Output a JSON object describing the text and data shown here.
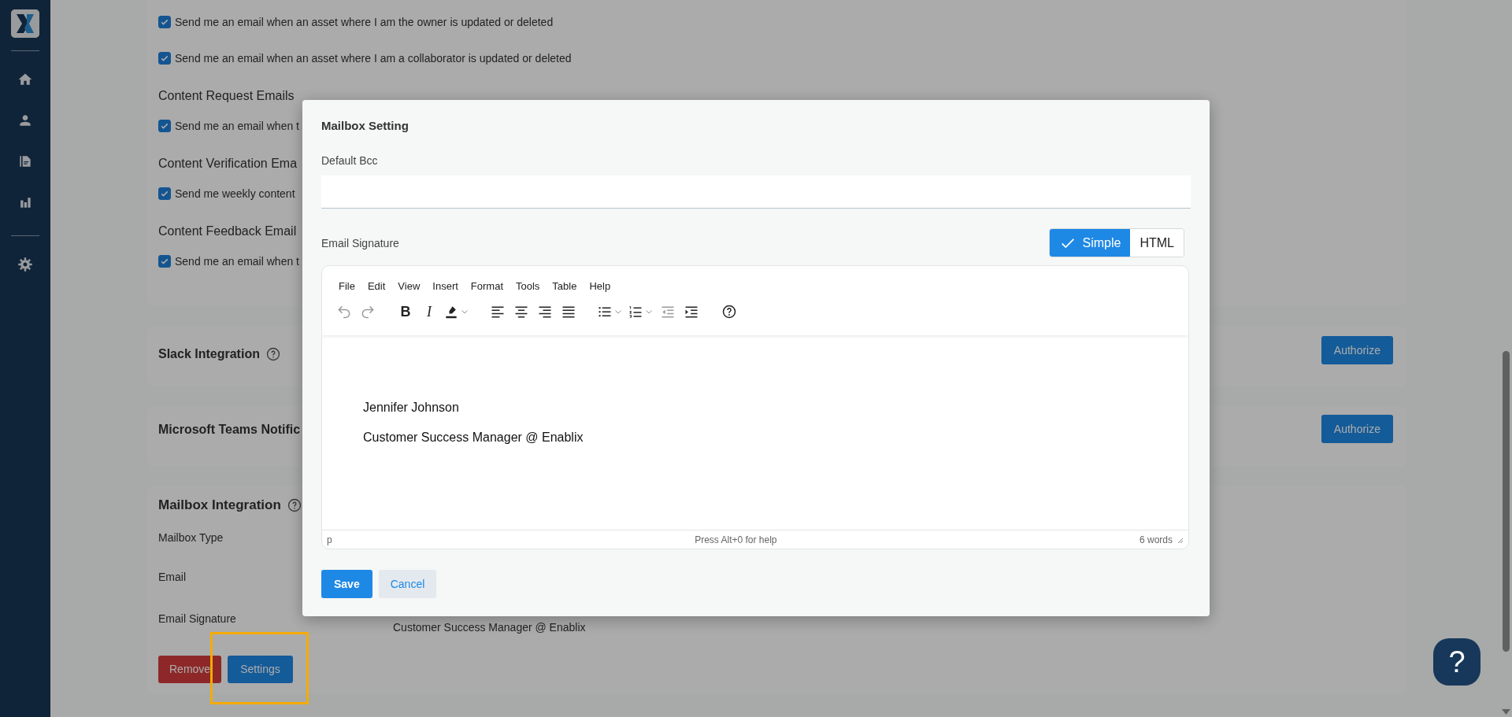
{
  "notifications": [
    {
      "kind": "checkbox",
      "label": "Send me an email when an asset where I am the owner is updated or deleted",
      "checked": true
    },
    {
      "kind": "checkbox",
      "label": "Send me an email when an asset where I am a collaborator is updated or deleted",
      "checked": true
    },
    {
      "kind": "heading",
      "label": "Content Request Emails"
    },
    {
      "kind": "checkbox",
      "label": "Send me an email when t",
      "checked": true
    },
    {
      "kind": "heading",
      "label": "Content Verification Ema"
    },
    {
      "kind": "checkbox",
      "label": "Send me weekly content",
      "checked": true
    },
    {
      "kind": "heading",
      "label": "Content Feedback Email"
    },
    {
      "kind": "checkbox",
      "label": "Send me an email when t",
      "checked": true
    }
  ],
  "integrations": [
    {
      "title": "Slack Integration",
      "help": true,
      "button": "Authorize"
    },
    {
      "title": "Microsoft Teams Notific",
      "button": "Authorize"
    }
  ],
  "mailbox": {
    "title": "Mailbox Integration",
    "fields": [
      {
        "label": "Mailbox Type"
      },
      {
        "label": "Email"
      },
      {
        "label": "Email Signature",
        "values": [
          "Customer Success  Manager @ Enablix"
        ]
      }
    ],
    "buttons": [
      {
        "label": "Remove",
        "kind": "danger"
      },
      {
        "label": "Settings",
        "kind": "primary",
        "highlighted": true
      }
    ]
  },
  "modal": {
    "title": "Mailbox Setting",
    "bcc_label": "Default Bcc",
    "signature_label": "Email Signature",
    "modes": [
      {
        "label": "Simple",
        "selected": true
      },
      {
        "label": "HTML",
        "selected": false
      }
    ],
    "menu": [
      "File",
      "Edit",
      "View",
      "Insert",
      "Format",
      "Tools",
      "Table",
      "Help"
    ],
    "toolbar_groups": [
      {
        "tools": [
          {
            "kind": "undo",
            "disabled": true
          },
          {
            "kind": "redo",
            "disabled": true
          }
        ]
      },
      {
        "tools": [
          {
            "kind": "bold",
            "label": "B",
            "disabled": false
          },
          {
            "kind": "italic",
            "label": "I",
            "disabled": false
          },
          {
            "kind": "highlight",
            "disabled": false
          }
        ]
      },
      {
        "tools": [
          {
            "kind": "align-left",
            "disabled": false
          },
          {
            "kind": "align-center",
            "disabled": false
          },
          {
            "kind": "align-right",
            "disabled": false
          },
          {
            "kind": "justify",
            "disabled": false
          }
        ]
      },
      {
        "tools": [
          {
            "kind": "bullet-list",
            "disabled": false
          },
          {
            "kind": "numbered-list",
            "disabled": false
          },
          {
            "kind": "outdent",
            "disabled": true
          },
          {
            "kind": "indent",
            "disabled": false
          }
        ]
      },
      {
        "tools": [
          {
            "kind": "help",
            "disabled": false
          }
        ]
      }
    ],
    "body": [
      "Jennifer Johnson",
      "Customer Success  Manager @ Enablix"
    ],
    "status_path": "p",
    "status_hint": "Press Alt+0 for help",
    "word_count": "6 words",
    "buttons": [
      {
        "label": "Save",
        "kind": "primary"
      },
      {
        "label": "Cancel",
        "kind": "secondary"
      }
    ]
  },
  "help_button": "?"
}
